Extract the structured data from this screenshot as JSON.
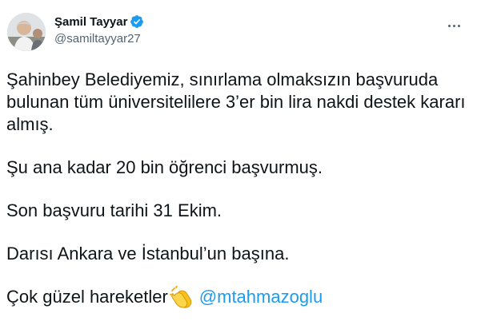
{
  "tweet": {
    "author": {
      "display_name": "Şamil Tayyar",
      "handle": "@samiltayyar27",
      "verified": true,
      "avatar_icon": "profile-photo"
    },
    "more_icon": "more-options-icon",
    "paragraphs": [
      "Şahinbey Belediyemiz, sınırlama olmaksızın başvuruda bulunan tüm üniversitelilere 3’er bin lira nakdi destek kararı almış.",
      "Şu ana kadar 20 bin öğrenci başvurmuş.",
      "Son başvuru tarihi 31 Ekim.",
      "Darısı Ankara ve İstanbul’un başına."
    ],
    "last_line": {
      "text": "Çok güzel hareketler",
      "emoji": "clapping-hands",
      "mention": "@mtahmazoglu"
    },
    "colors": {
      "text": "#0f1419",
      "secondary": "#536471",
      "link": "#1d9bf0",
      "verified_badge": "#1d9bf0"
    }
  }
}
